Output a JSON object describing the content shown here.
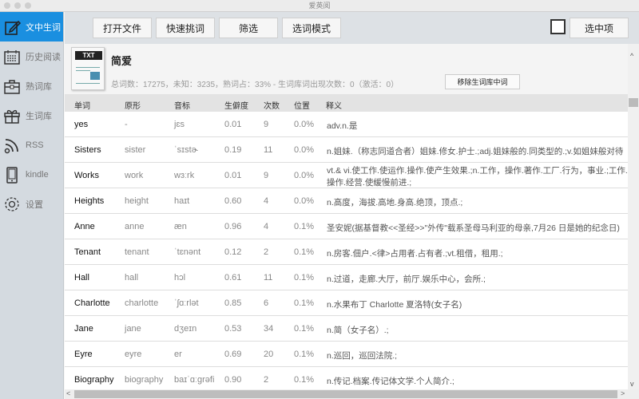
{
  "window": {
    "title": "爱英阅"
  },
  "sidebar": {
    "items": [
      {
        "label": "文中生词",
        "icon": "edit-icon",
        "active": true
      },
      {
        "label": "历史阅读",
        "icon": "calendar-icon"
      },
      {
        "label": "熟词库",
        "icon": "briefcase-icon"
      },
      {
        "label": "生词库",
        "icon": "gift-icon"
      },
      {
        "label": "RSS",
        "icon": "rss-icon"
      },
      {
        "label": "kindle",
        "icon": "tablet-icon"
      },
      {
        "label": "设置",
        "icon": "gear-icon"
      }
    ]
  },
  "toolbar": {
    "open": "打开文件",
    "quick": "快速挑词",
    "filter": "筛选",
    "mode": "选词模式",
    "selected": "选中项"
  },
  "info": {
    "title": "简爱",
    "file_badge": "TXT",
    "stats": "总词数：17275，未知：3235，熟词占：33% - 生词库词出现次数：0（激活：0）",
    "remove": "移除生词库中词"
  },
  "table": {
    "headers": [
      "单词",
      "原形",
      "音标",
      "生僻度",
      "次数",
      "位置",
      "释义"
    ],
    "rows": [
      [
        "yes",
        "-",
        "jɛs",
        "0.01",
        "9",
        "0.0%",
        "adv.n.是"
      ],
      [
        "Sisters",
        "sister",
        "ˈsɪstɚ",
        "0.19",
        "11",
        "0.0%",
        "n.姐妹.（称志同道合者）姐妹.修女.护士.;adj.姐妹般的.同类型的.;v.如姐妹般对待"
      ],
      [
        "Works",
        "work",
        "wɜːrk",
        "0.01",
        "9",
        "0.0%",
        "vt.& vi.使工作.使运作.操作.使产生效果.;n.工作，操作.著作.工厂.行为，事业.;工作.操作.经营.使缓慢前进.;"
      ],
      [
        "Heights",
        "height",
        "haɪt",
        "0.60",
        "4",
        "0.0%",
        "n.高度，海拔.高地.身高.绝顶，顶点.;"
      ],
      [
        "Anne",
        "anne",
        "æn",
        "0.96",
        "4",
        "0.1%",
        " 圣安妮(据基督教<<圣经>>\"外传\"载系圣母马利亚的母亲,7月26 日是她的纪念日)"
      ],
      [
        "Tenant",
        "tenant",
        "ˈtɛnənt",
        "0.12",
        "2",
        "0.1%",
        "n.房客.佃户.<律>占用者.占有者.;vt.租借，租用.;"
      ],
      [
        "Hall",
        "hall",
        "hɔl",
        "0.61",
        "11",
        "0.1%",
        "n.过道，走廊.大厅，前厅.娱乐中心，会所.;"
      ],
      [
        "Charlotte",
        "charlotte",
        "ˈʃɑːrlət",
        "0.85",
        "6",
        "0.1%",
        "n.水果布丁 Charlotte 夏洛特(女子名)"
      ],
      [
        "Jane",
        "jane",
        "dʒeɪn",
        "0.53",
        "34",
        "0.1%",
        "n.简（女子名）.;"
      ],
      [
        "Eyre",
        "eyre",
        "er",
        "0.69",
        "20",
        "0.1%",
        "n.巡回，巡回法院.;"
      ],
      [
        "Biography",
        "biography",
        "baɪˈɑːgrəfi",
        "0.90",
        "2",
        "0.1%",
        "n.传记.档案.传记体文学.个人简介.;"
      ]
    ]
  },
  "colors": {
    "accent": "#1a8fe0",
    "sidebar": "#d4dae0",
    "toolbar": "#dde1e5"
  }
}
